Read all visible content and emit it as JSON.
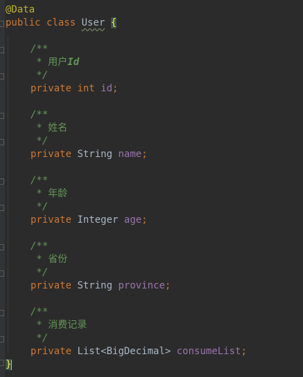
{
  "code": {
    "annotation": "@Data",
    "class_decl": {
      "kw_public": "public",
      "kw_class": "class",
      "name": "User",
      "open_brace": "{"
    },
    "fields": [
      {
        "comment_open": "/**",
        "comment_star": " * ",
        "comment_text": "用户",
        "comment_tag": "Id",
        "comment_close": " */",
        "kw_private": "private",
        "type": "int",
        "name": "id",
        "semi": ";"
      },
      {
        "comment_open": "/**",
        "comment_star": " * ",
        "comment_text": "姓名",
        "comment_close": " */",
        "kw_private": "private",
        "type": "String",
        "name": "name",
        "semi": ";"
      },
      {
        "comment_open": "/**",
        "comment_star": " * ",
        "comment_text": "年龄",
        "comment_close": " */",
        "kw_private": "private",
        "type": "Integer",
        "name": "age",
        "semi": ";"
      },
      {
        "comment_open": "/**",
        "comment_star": " * ",
        "comment_text": "省份",
        "comment_close": " */",
        "kw_private": "private",
        "type": "String",
        "name": "province",
        "semi": ";"
      },
      {
        "comment_open": "/**",
        "comment_star": " * ",
        "comment_text": "消费记录",
        "comment_close": " */",
        "kw_private": "private",
        "type": "List<BigDecimal>",
        "name": "consumeList",
        "semi": ";"
      }
    ],
    "close_brace": "}"
  },
  "colors": {
    "background": "#2b2b2b",
    "keyword": "#cc7832",
    "annotation": "#bbb529",
    "comment": "#629755",
    "field": "#9876aa",
    "plain": "#a9b7c6"
  }
}
